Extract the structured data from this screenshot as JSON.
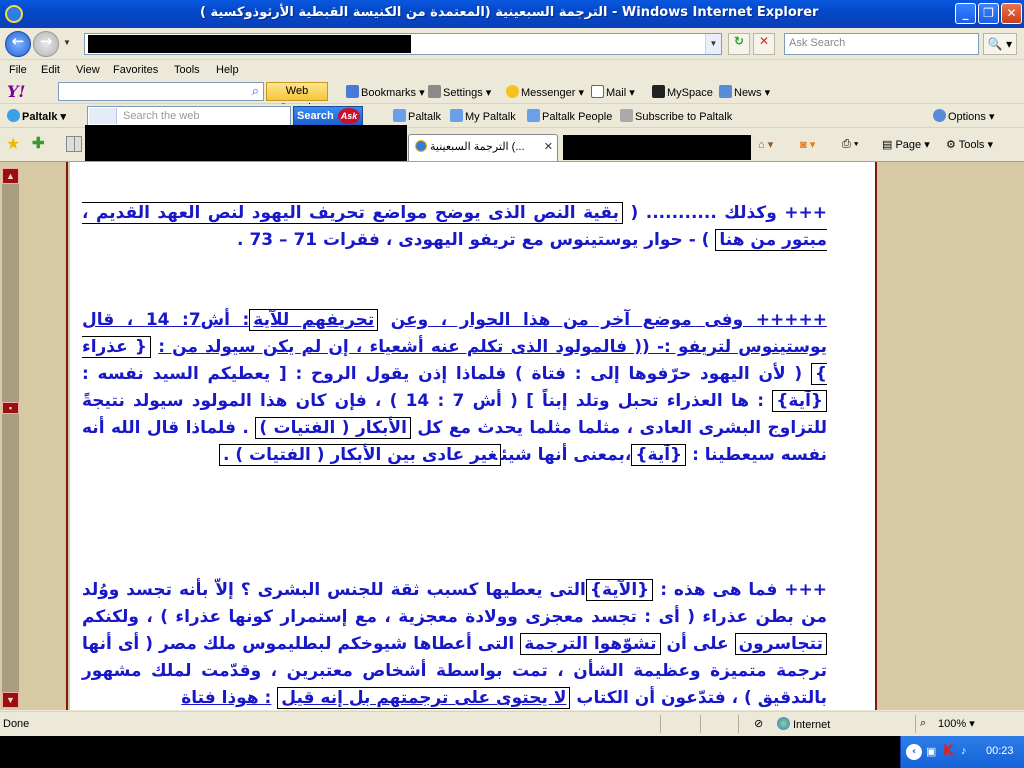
{
  "window": {
    "title": "الترجمة السبعينية (المعتمدة من الكنيسة القبطية الأرثوذوكسية ) - Windows Internet Explorer",
    "min_glyph": "_",
    "max_glyph": "❐",
    "close_glyph": "✕"
  },
  "address": {
    "refresh_glyph": "↻",
    "stop_glyph": "✕",
    "search_placeholder": "Ask Search",
    "search_glyph": "🔍 ▾"
  },
  "menu": {
    "file": "File",
    "edit": "Edit",
    "view": "View",
    "favorites": "Favorites",
    "tools": "Tools",
    "help": "Help"
  },
  "yahoo_toolbar": {
    "logo": "Y!",
    "web_search": "Web Search",
    "bookmarks": "Bookmarks",
    "settings": "Settings",
    "messenger": "Messenger",
    "mail": "Mail",
    "myspace": "MySpace",
    "news": "News"
  },
  "paltalk_toolbar": {
    "brand": "Paltalk",
    "search_placeholder": "Search the web",
    "search_button": "Search",
    "ask_logo": "Ask",
    "paltalk": "Paltalk",
    "my_paltalk": "My Paltalk",
    "paltalk_people": "Paltalk People",
    "subscribe": "Subscribe to Paltalk",
    "options": "Options"
  },
  "tabs": {
    "active_tab": "الترجمة السبعينية (...",
    "page": "Page",
    "tools": "Tools"
  },
  "content": {
    "p1": {
      "lead": "+++ وكذلك ........... (",
      "box1": "بقية النص الذى يوضح مواضع تحريف اليهود لنص العهد القديم ، مبتور من هنا",
      "tail": ") - حوار يوستينوس مع تريفو اليهودى ، فقرات 71 – 73 ."
    },
    "p2": {
      "lead": "+++++ وفى موضع آخر من هذا الحوار ، وعن",
      "box1": "تحريفهم للآية",
      "ref": ": أش7: 14 ، قال يوستينوس لتريفو :- (( فالمولود الذى تكلم عنه أشعياء ، إن لم يكن سيولد من :",
      "box2": "{ عذراء }",
      "mid1": "( لأن اليهود حرّفوها إلى : فتاة ) فلماذا إذن يقول الروح : [ يعطيكم السيد نفسه :",
      "box3": "{آية}",
      "mid2": ": ها العذراء تحبل وتلد إبناً ] ( أش 7 : 14 ) ، فإن كان هذا المولود سيولد نتيجةً للتزاوج البشرى العادى ، مثلما مثلما يحدث مع كل",
      "box4": "الأبكار ( الفتيات )",
      "mid3": ". فلماذا قال الله أنه نفسه سيعطينا :",
      "box5": "{آية}",
      "mid4": "،بمعنى أنها شيئ",
      "box6": "غير عادى بين الأبكار ( الفتيات ) ."
    },
    "p3": {
      "lead": "+++ فما هى هذه :",
      "box1": "{الآية}",
      "mid1": "التى يعطيها كسبب ثقة للجنس البشرى ؟ إلاّ بأنه تجسد ووُلد من بطن عذراء ( أى : تجسد معجزى وولادة معجزية ، مع إستمرار كونها عذراء ) ، ولكنكم",
      "box2": "تتجاسرون",
      "mid2": "على أن",
      "box3": "تشوّهوا الترجمة",
      "mid3": "التى أعطاها شيوخكم لبطليموس ملك مصر ( أى أنها ترجمة متميزة وعظيمة الشأن ، تمت بواسطة أشخاص معتبرين ، وقدّمت لملك مشهور بالتدقيق ) ، فتدّعون أن الكتاب",
      "box4": "لا يحتوى على ترجمتهم بل إنه قيل",
      "tail": ": هوذا فتاة"
    }
  },
  "status": {
    "done": "Done",
    "zone": "Internet",
    "zoom": "100% ▾"
  },
  "taskbar": {
    "tray_arrow": "‹",
    "k_icon": "K",
    "time": "00:23"
  }
}
